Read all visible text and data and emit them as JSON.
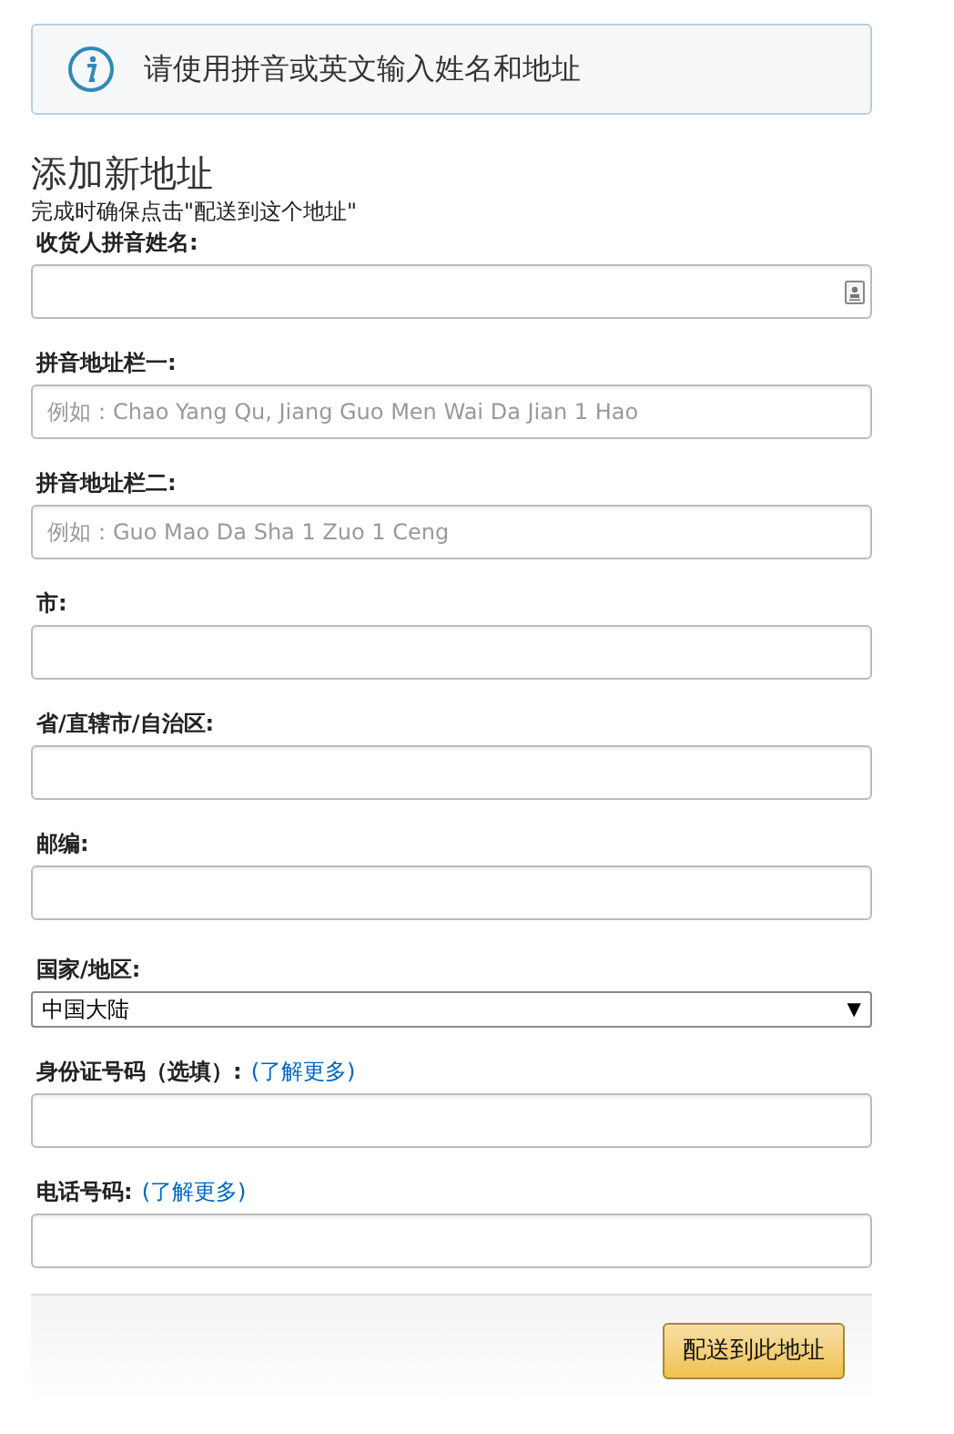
{
  "notice": "请使用拼音或英文输入姓名和地址",
  "heading": "添加新地址",
  "note": "完成时确保点击\"配送到这个地址\"",
  "fields": [
    {
      "kind": "contact",
      "label": "收货人拼音姓名:"
    },
    {
      "kind": "text",
      "label": "拼音地址栏一:",
      "placeholder": "例如：Chao Yang Qu, Jiang Guo Men Wai Da Jian 1 Hao"
    },
    {
      "kind": "text",
      "label": "拼音地址栏二:",
      "placeholder": "例如：Guo Mao Da Sha 1 Zuo 1 Ceng"
    },
    {
      "kind": "text",
      "label": "市:"
    },
    {
      "kind": "text",
      "label": "省/直辖市/自治区:"
    },
    {
      "kind": "text",
      "label": "邮编:"
    },
    {
      "kind": "select",
      "label": "国家/地区:",
      "value": "中国大陆",
      "arrow": "▼"
    },
    {
      "kind": "text",
      "label": "身份证号码（选填）:",
      "link": "(了解更多)"
    },
    {
      "kind": "text",
      "label": "电话号码:",
      "link": "(了解更多)"
    }
  ],
  "submit": "配送到此地址"
}
